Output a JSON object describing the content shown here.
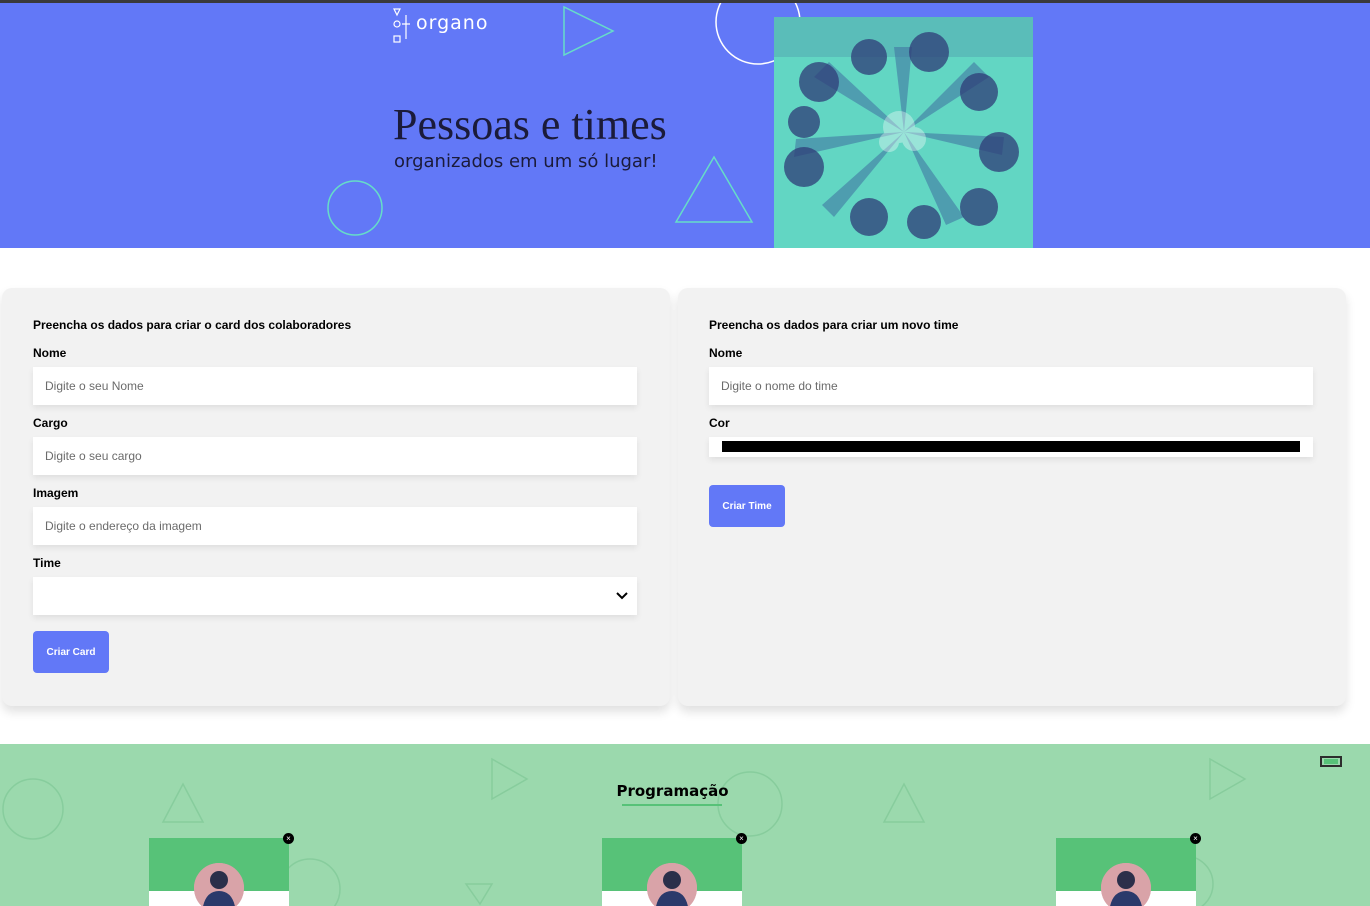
{
  "banner": {
    "logo_text": "organo",
    "title": "Pessoas e times",
    "subtitle": "organizados em um só lugar!",
    "colors": {
      "background": "#6278f7",
      "accent_line": "#66ddc8"
    }
  },
  "collaborator_form": {
    "heading": "Preencha os dados para criar o card dos colaboradores",
    "fields": [
      {
        "label": "Nome",
        "placeholder": "Digite o seu Nome",
        "value": ""
      },
      {
        "label": "Cargo",
        "placeholder": "Digite o seu cargo",
        "value": ""
      },
      {
        "label": "Imagem",
        "placeholder": "Digite o endereço da imagem",
        "value": ""
      }
    ],
    "select": {
      "label": "Time",
      "selected": ""
    },
    "submit_label": "Criar Card"
  },
  "team_form": {
    "heading": "Preencha os dados para criar um novo time",
    "name_field": {
      "label": "Nome",
      "placeholder": "Digite o nome do time",
      "value": ""
    },
    "color_field": {
      "label": "Cor",
      "value": "#000000"
    },
    "submit_label": "Criar Time"
  },
  "team_section": {
    "title": "Programação",
    "colors": {
      "background": "#9bd9ad",
      "primary": "#57c278"
    },
    "members": [
      {
        "delete_label": "×"
      },
      {
        "delete_label": "×"
      },
      {
        "delete_label": "×"
      }
    ]
  }
}
